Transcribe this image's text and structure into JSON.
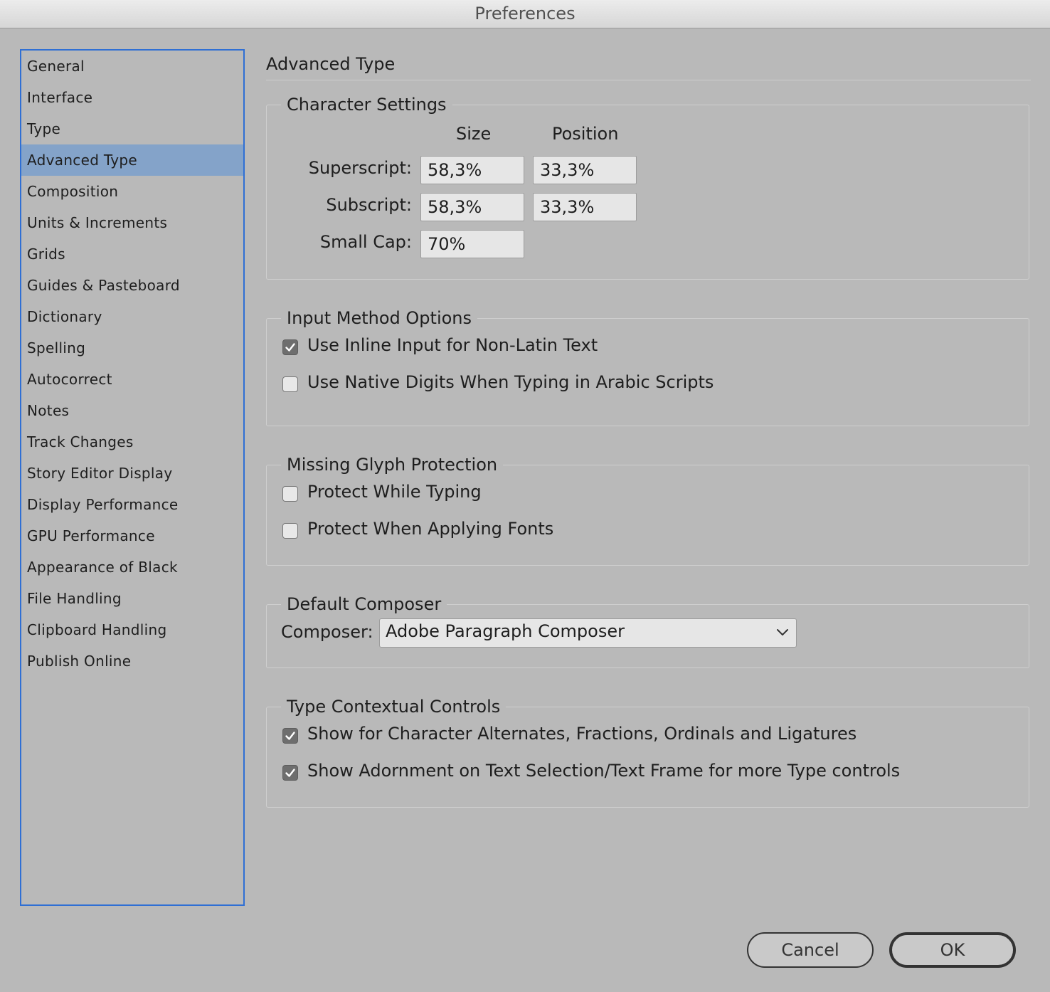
{
  "window": {
    "title": "Preferences"
  },
  "sidebar": {
    "selected_index": 3,
    "items": [
      {
        "label": "General"
      },
      {
        "label": "Interface"
      },
      {
        "label": "Type"
      },
      {
        "label": "Advanced Type"
      },
      {
        "label": "Composition"
      },
      {
        "label": "Units & Increments"
      },
      {
        "label": "Grids"
      },
      {
        "label": "Guides & Pasteboard"
      },
      {
        "label": "Dictionary"
      },
      {
        "label": "Spelling"
      },
      {
        "label": "Autocorrect"
      },
      {
        "label": "Notes"
      },
      {
        "label": "Track Changes"
      },
      {
        "label": "Story Editor Display"
      },
      {
        "label": "Display Performance"
      },
      {
        "label": "GPU Performance"
      },
      {
        "label": "Appearance of Black"
      },
      {
        "label": "File Handling"
      },
      {
        "label": "Clipboard Handling"
      },
      {
        "label": "Publish Online"
      }
    ]
  },
  "main": {
    "title": "Advanced Type",
    "character_settings": {
      "legend": "Character Settings",
      "size_header": "Size",
      "position_header": "Position",
      "superscript": {
        "label": "Superscript:",
        "size": "58,3%",
        "position": "33,3%"
      },
      "subscript": {
        "label": "Subscript:",
        "size": "58,3%",
        "position": "33,3%"
      },
      "small_cap": {
        "label": "Small Cap:",
        "size": "70%"
      }
    },
    "input_method": {
      "legend": "Input Method Options",
      "options": [
        {
          "label": "Use Inline Input for Non-Latin Text",
          "checked": true
        },
        {
          "label": "Use Native Digits When Typing in Arabic Scripts",
          "checked": false
        }
      ]
    },
    "missing_glyph": {
      "legend": "Missing Glyph Protection",
      "options": [
        {
          "label": "Protect While Typing",
          "checked": false
        },
        {
          "label": "Protect When Applying Fonts",
          "checked": false
        }
      ]
    },
    "default_composer": {
      "legend": "Default Composer",
      "label": "Composer:",
      "value": "Adobe Paragraph Composer"
    },
    "contextual_controls": {
      "legend": "Type Contextual Controls",
      "options": [
        {
          "label": "Show for Character Alternates, Fractions, Ordinals and Ligatures",
          "checked": true
        },
        {
          "label": "Show Adornment on Text Selection/Text Frame for more Type controls",
          "checked": true
        }
      ]
    }
  },
  "buttons": {
    "cancel": "Cancel",
    "ok": "OK"
  },
  "colors": {
    "selection": "#84a3c9",
    "focus_ring": "#2f6fd4",
    "window_bg": "#b9b9b9"
  }
}
